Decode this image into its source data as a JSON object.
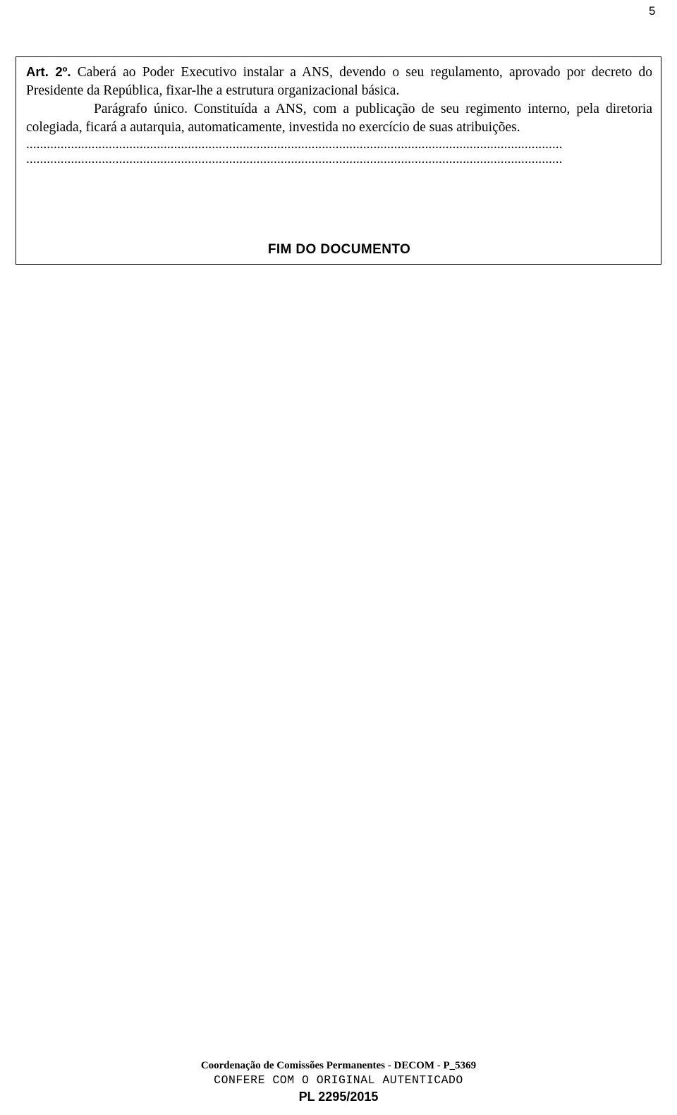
{
  "page": {
    "number": "5"
  },
  "document": {
    "paragraphs": [
      {
        "prefix": "Art. 2º.",
        "text": " Caberá ao Poder Executivo instalar a ANS, devendo o seu regulamento, aprovado por decreto do Presidente da República, fixar-lhe a estrutura organizacional básica."
      },
      {
        "prefix": "",
        "text": "Parágrafo único. Constituída a ANS, com a publicação de seu regimento interno, pela diretoria colegiada, ficará a autarquia, automaticamente, investida no exercício de suas atribuições."
      }
    ],
    "separator_1": "............................................................................................................................................................",
    "separator_2": "............................................................................................................................................................",
    "end_label": "FIM DO DOCUMENTO"
  },
  "footer": {
    "line1": "Coordenação de Comissões Permanentes - DECOM - P_5369",
    "line2": "CONFERE COM O ORIGINAL AUTENTICADO",
    "line3": "PL 2295/2015"
  }
}
